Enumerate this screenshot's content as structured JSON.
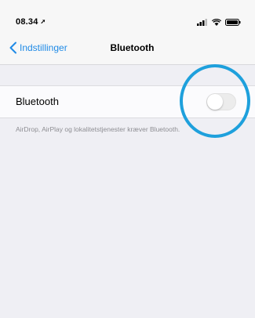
{
  "status_bar": {
    "time": "08.34",
    "location_icon": "location-arrow-icon",
    "icons": [
      "cellular-signal-icon",
      "wifi-icon",
      "battery-icon"
    ]
  },
  "nav": {
    "back_label": "Indstillinger",
    "title": "Bluetooth",
    "accent_color": "#1f8ae6"
  },
  "bluetooth_row": {
    "label": "Bluetooth",
    "toggle_on": false
  },
  "footer": {
    "text": "AirDrop, AirPlay og lokalitetstjenester kræver Bluetooth."
  },
  "annotation": {
    "highlight_color": "#1ea0dc"
  }
}
